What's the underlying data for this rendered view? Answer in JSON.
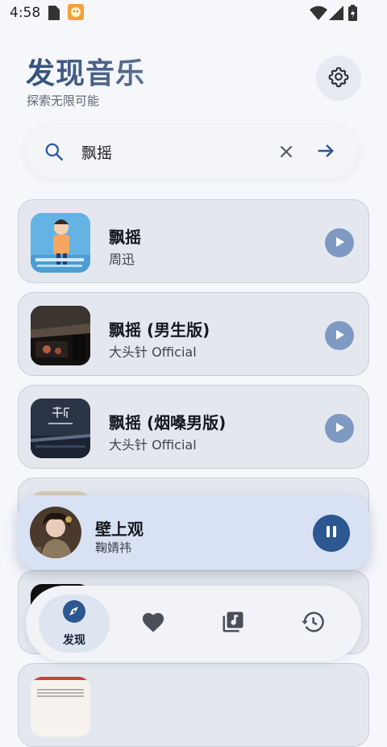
{
  "status": {
    "time": "4:58"
  },
  "header": {
    "title": "发现音乐",
    "subtitle": "探索无限可能"
  },
  "search": {
    "value": "飘摇"
  },
  "songs": [
    {
      "title": "飘摇",
      "artist": "周迅"
    },
    {
      "title": "飘摇 (男生版)",
      "artist": "大头针 Official"
    },
    {
      "title": "飘摇 (烟嗓男版)",
      "artist": "大头针 Official"
    }
  ],
  "now_playing": {
    "title": "壁上观",
    "artist": "鞠婧祎"
  },
  "nav": {
    "discover_label": "发现"
  },
  "colors": {
    "accent": "#2c5790",
    "play_button": "#7e9ac3",
    "card_bg": "#e4e8ee",
    "background": "#f5f7fb"
  }
}
